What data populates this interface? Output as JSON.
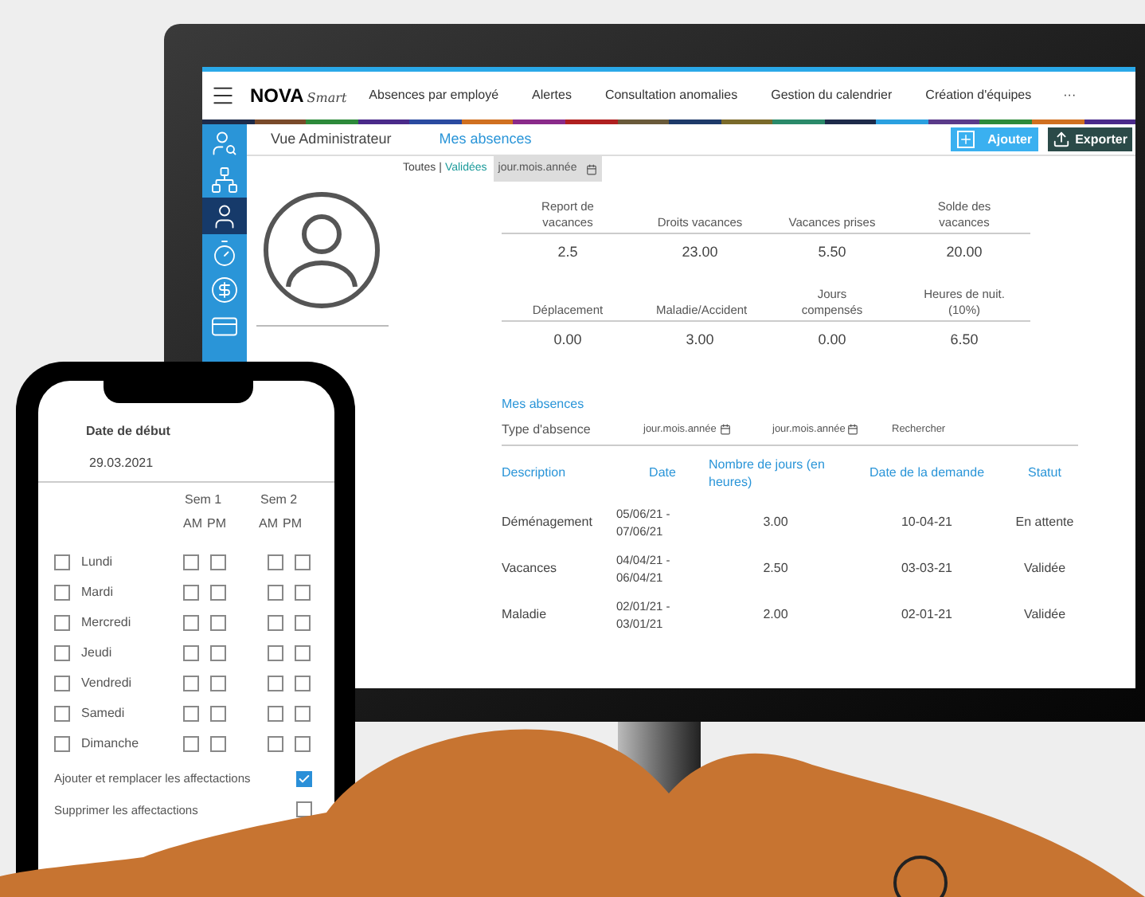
{
  "desktop": {
    "brand": {
      "name": "NOVA",
      "script": "Smart"
    },
    "nav": [
      "Absences par employé",
      "Alertes",
      "Consultation anomalies",
      "Gestion du calendrier",
      "Création d'équipes"
    ],
    "nav_more": "···",
    "sidebar": {
      "items": [
        {
          "kind": "search-user",
          "selected": false
        },
        {
          "kind": "network",
          "selected": false
        },
        {
          "kind": "user",
          "selected": true
        },
        {
          "kind": "timer",
          "selected": false
        },
        {
          "kind": "dollar",
          "selected": false
        },
        {
          "kind": "cards",
          "selected": false
        }
      ]
    },
    "tabs": [
      {
        "label": "Vue Administrateur",
        "selected": false
      },
      {
        "label": "Mes absences",
        "selected": true
      }
    ],
    "buttons": [
      {
        "kind": "add",
        "label": "Ajouter"
      },
      {
        "kind": "export",
        "label": "Exporter"
      }
    ],
    "filter": {
      "options": [
        {
          "label": "Toutes",
          "selected": false
        },
        {
          "label": "Validées",
          "selected": true
        }
      ],
      "separator": "|",
      "date_placeholder": "jour.mois.année"
    },
    "stats": [
      [
        {
          "label": "Report de vacances",
          "value": "2.5"
        },
        {
          "label": "Droits vacances",
          "value": "23.00"
        },
        {
          "label": "Vacances prises",
          "value": "5.50"
        },
        {
          "label": "Solde des vacances",
          "value": "20.00"
        }
      ],
      [
        {
          "label": "Déplacement",
          "value": "0.00"
        },
        {
          "label": "Maladie/Accident",
          "value": "3.00"
        },
        {
          "label": "Jours compensés",
          "value": "0.00"
        },
        {
          "label": "Heures de nuit. (10%)",
          "value": "6.50"
        }
      ]
    ],
    "section_title": "Mes absences",
    "search": {
      "type_label": "Type d'absence",
      "from_placeholder": "jour.mois.année",
      "to_placeholder": "jour.mois.année",
      "button": "Rechercher"
    },
    "table": {
      "columns": [
        "Description",
        "Date",
        "Nombre de jours (en heures)",
        "Date de la demande",
        "Statut"
      ],
      "rows": [
        [
          "Déménagement",
          "05/06/21 - 07/06/21",
          "3.00",
          "10-04-21",
          "En attente"
        ],
        [
          "Vacances",
          "04/04/21 - 06/04/21",
          "2.50",
          "03-03-21",
          "Validée"
        ],
        [
          "Maladie",
          "02/01/21 - 03/01/21",
          "2.00",
          "02-01-21",
          "Validée"
        ]
      ]
    }
  },
  "phone": {
    "start_label": "Date de début",
    "start_value": "29.03.2021",
    "weeks": [
      {
        "label": "Sem 1",
        "am": "AM",
        "pm": "PM"
      },
      {
        "label": "Sem 2",
        "am": "AM",
        "pm": "PM"
      }
    ],
    "days": [
      {
        "name": "Lundi",
        "checked": false,
        "slots": [
          false,
          false,
          false,
          false
        ]
      },
      {
        "name": "Mardi",
        "checked": false,
        "slots": [
          false,
          false,
          false,
          false
        ]
      },
      {
        "name": "Mercredi",
        "checked": false,
        "slots": [
          false,
          false,
          false,
          false
        ]
      },
      {
        "name": "Jeudi",
        "checked": false,
        "slots": [
          false,
          false,
          false,
          false
        ]
      },
      {
        "name": "Vendredi",
        "checked": false,
        "slots": [
          false,
          false,
          false,
          false
        ]
      },
      {
        "name": "Samedi",
        "checked": false,
        "slots": [
          false,
          false,
          false,
          false
        ]
      },
      {
        "name": "Dimanche",
        "checked": false,
        "slots": [
          false,
          false,
          false,
          false
        ]
      }
    ],
    "options": [
      {
        "label": "Ajouter et remplacer les affectactions",
        "checked": true
      },
      {
        "label": "Supprimer les affectactions",
        "checked": false
      }
    ]
  }
}
